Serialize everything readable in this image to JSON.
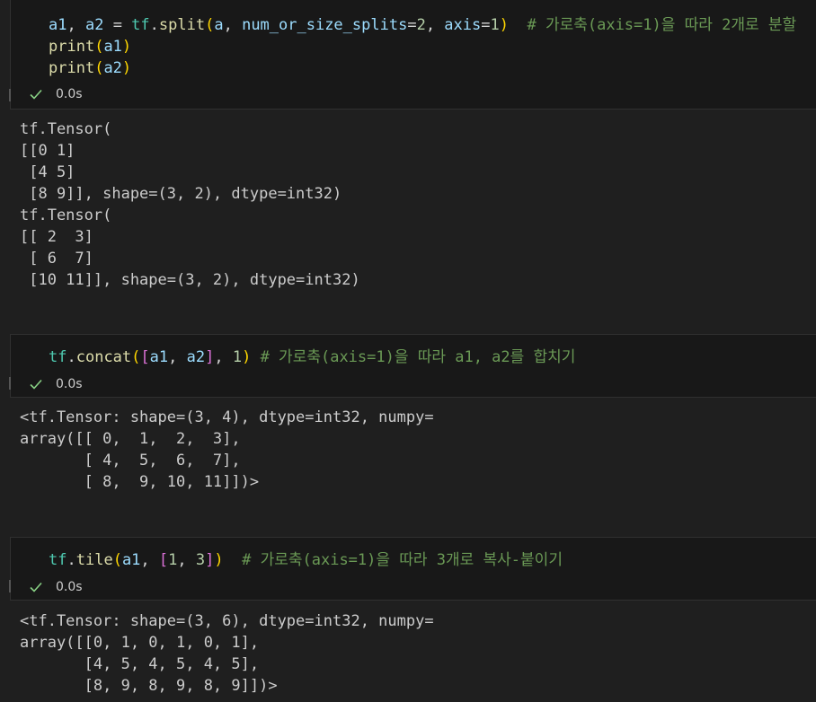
{
  "cells": [
    {
      "code_lines": [
        [
          {
            "t": "a1",
            "k": "v"
          },
          {
            "t": ", ",
            "k": "p"
          },
          {
            "t": "a2",
            "k": "v"
          },
          {
            "t": " = ",
            "k": "p"
          },
          {
            "t": "tf",
            "k": "m"
          },
          {
            "t": ".",
            "k": "p"
          },
          {
            "t": "split",
            "k": "f"
          },
          {
            "t": "(",
            "k": "b1"
          },
          {
            "t": "a",
            "k": "v"
          },
          {
            "t": ", ",
            "k": "p"
          },
          {
            "t": "num_or_size_splits",
            "k": "v"
          },
          {
            "t": "=",
            "k": "p"
          },
          {
            "t": "2",
            "k": "n"
          },
          {
            "t": ", ",
            "k": "p"
          },
          {
            "t": "axis",
            "k": "v"
          },
          {
            "t": "=",
            "k": "p"
          },
          {
            "t": "1",
            "k": "n"
          },
          {
            "t": ")",
            "k": "b1"
          },
          {
            "t": "  # 가로축(axis=1)을 따라 2개로 분할",
            "k": "c"
          }
        ],
        [
          {
            "t": "print",
            "k": "f"
          },
          {
            "t": "(",
            "k": "b1"
          },
          {
            "t": "a1",
            "k": "v"
          },
          {
            "t": ")",
            "k": "b1"
          }
        ],
        [
          {
            "t": "print",
            "k": "f"
          },
          {
            "t": "(",
            "k": "b1"
          },
          {
            "t": "a2",
            "k": "v"
          },
          {
            "t": ")",
            "k": "b1"
          }
        ]
      ],
      "status": "0.0s",
      "output": "tf.Tensor(\n[[0 1]\n [4 5]\n [8 9]], shape=(3, 2), dtype=int32)\ntf.Tensor(\n[[ 2  3]\n [ 6  7]\n [10 11]], shape=(3, 2), dtype=int32)"
    },
    {
      "code_lines": [
        [
          {
            "t": "tf",
            "k": "m"
          },
          {
            "t": ".",
            "k": "p"
          },
          {
            "t": "concat",
            "k": "f"
          },
          {
            "t": "(",
            "k": "b1"
          },
          {
            "t": "[",
            "k": "b2"
          },
          {
            "t": "a1",
            "k": "v"
          },
          {
            "t": ", ",
            "k": "p"
          },
          {
            "t": "a2",
            "k": "v"
          },
          {
            "t": "]",
            "k": "b2"
          },
          {
            "t": ", ",
            "k": "p"
          },
          {
            "t": "1",
            "k": "n"
          },
          {
            "t": ")",
            "k": "b1"
          },
          {
            "t": " # 가로축(axis=1)을 따라 a1, a2를 합치기",
            "k": "c"
          }
        ]
      ],
      "status": "0.0s",
      "output": "<tf.Tensor: shape=(3, 4), dtype=int32, numpy=\narray([[ 0,  1,  2,  3],\n       [ 4,  5,  6,  7],\n       [ 8,  9, 10, 11]])>"
    },
    {
      "code_lines": [
        [
          {
            "t": "tf",
            "k": "m"
          },
          {
            "t": ".",
            "k": "p"
          },
          {
            "t": "tile",
            "k": "f"
          },
          {
            "t": "(",
            "k": "b1"
          },
          {
            "t": "a1",
            "k": "v"
          },
          {
            "t": ", ",
            "k": "p"
          },
          {
            "t": "[",
            "k": "b2"
          },
          {
            "t": "1",
            "k": "n"
          },
          {
            "t": ", ",
            "k": "p"
          },
          {
            "t": "3",
            "k": "n"
          },
          {
            "t": "]",
            "k": "b2"
          },
          {
            "t": ")",
            "k": "b1"
          },
          {
            "t": "  # 가로축(axis=1)을 따라 3개로 복사-붙이기",
            "k": "c"
          }
        ]
      ],
      "status": "0.0s",
      "output": "<tf.Tensor: shape=(3, 6), dtype=int32, numpy=\narray([[0, 1, 0, 1, 0, 1],\n       [4, 5, 4, 5, 4, 5],\n       [8, 9, 8, 9, 8, 9]])>"
    }
  ],
  "icons": {
    "status_check": "check-icon",
    "check_color": "#89d185"
  }
}
